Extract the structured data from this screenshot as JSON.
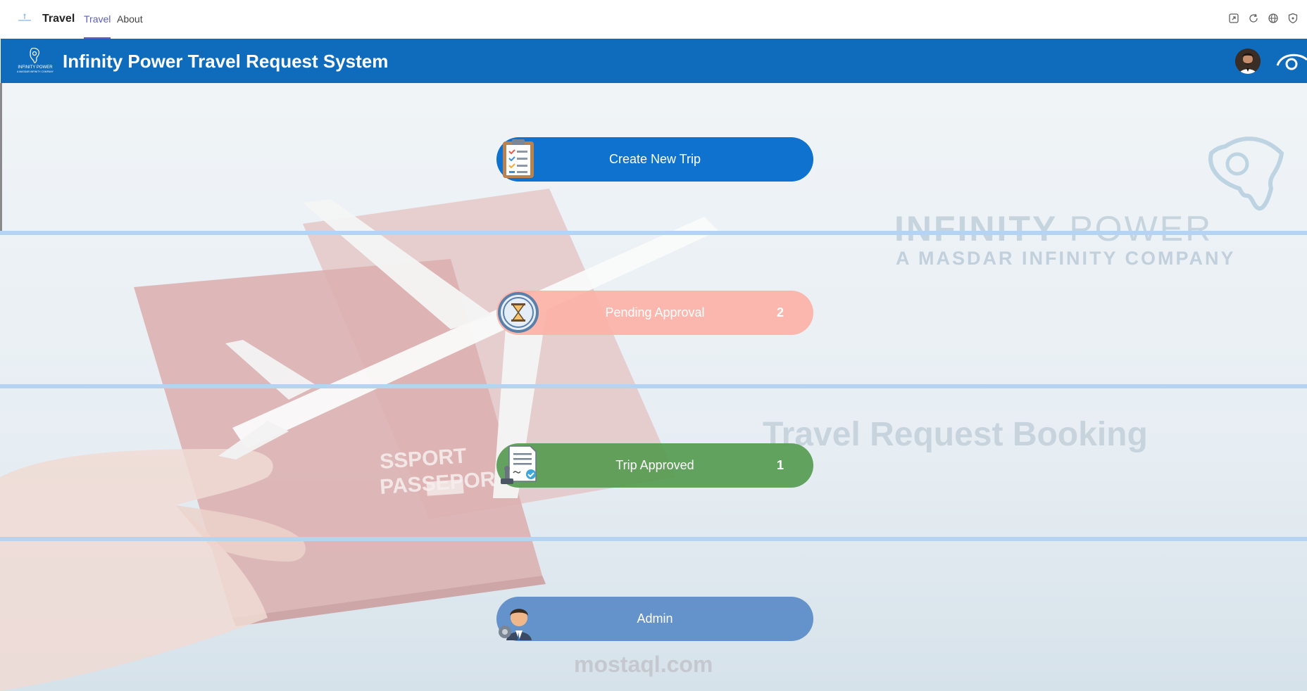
{
  "app": {
    "name": "Travel",
    "tabs": [
      {
        "label": "Travel",
        "active": true
      },
      {
        "label": "About",
        "active": false
      }
    ],
    "top_actions": [
      "popout-icon",
      "refresh-icon",
      "globe-icon",
      "shield-icon"
    ]
  },
  "header": {
    "title": "Infinity Power Travel Request System",
    "logo_text": "INFINITY POWER",
    "logo_subtext": "A MASDAR INFINITY COMPANY",
    "color": "#0f6cbd"
  },
  "actions": [
    {
      "label": "Create New Trip",
      "count": "",
      "icon": "clipboard-checklist-icon",
      "color": "#0f72cf"
    },
    {
      "label": "Pending Approval",
      "count": "2",
      "icon": "hourglass-icon",
      "color": "#fcb2a6"
    },
    {
      "label": "Trip Approved",
      "count": "1",
      "icon": "approved-document-icon",
      "color": "#569b51"
    },
    {
      "label": "Admin",
      "count": "",
      "icon": "admin-user-icon",
      "color": "#5a8bc7"
    }
  ],
  "watermarks": {
    "company_bold": "INFINITY",
    "company_light": "POWER",
    "company_sub": "A MASDAR INFINITY COMPANY",
    "tagline": "Travel Request Booking",
    "site": "mostaql.com",
    "passport": "PASSEPORT"
  }
}
